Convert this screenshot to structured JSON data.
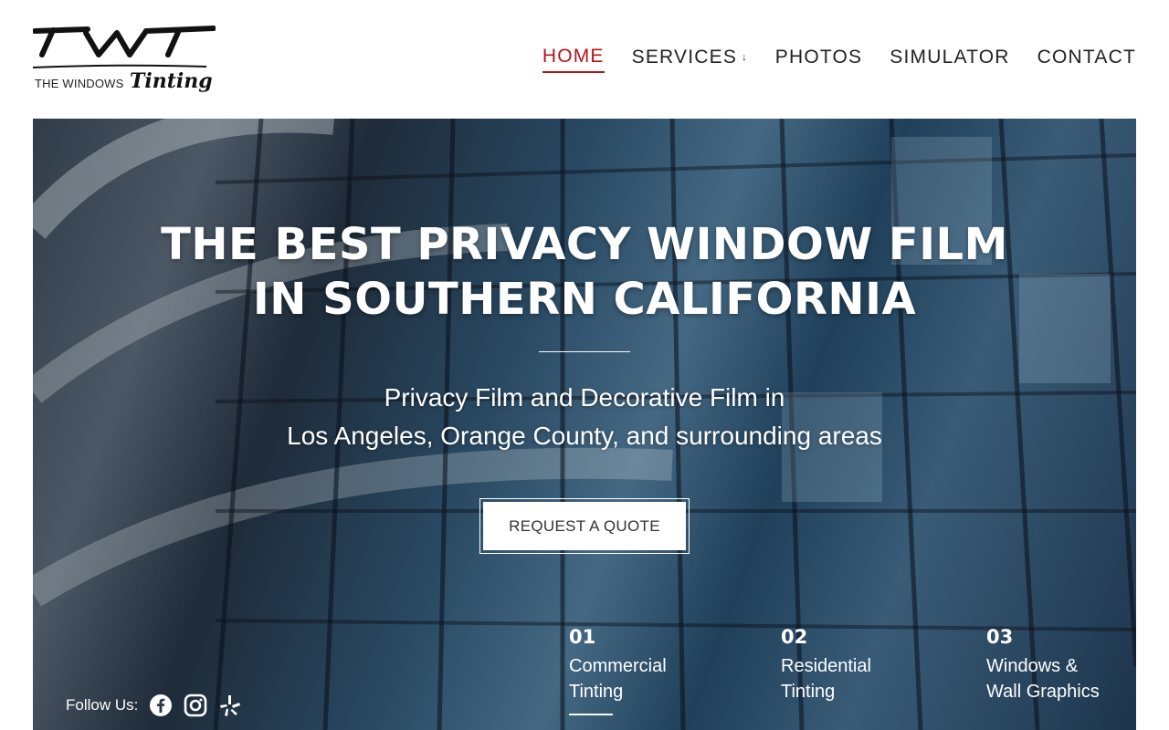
{
  "brand": {
    "logo_mark": "TWT",
    "logo_sub": "THE WINDOWS",
    "logo_script": "Tinting"
  },
  "nav": {
    "items": [
      {
        "label": "HOME",
        "active": true
      },
      {
        "label": "SERVICES",
        "has_dropdown": true,
        "chevron": "↓"
      },
      {
        "label": "PHOTOS"
      },
      {
        "label": "SIMULATOR"
      },
      {
        "label": "CONTACT"
      }
    ]
  },
  "hero": {
    "title_line1": "THE BEST PRIVACY WINDOW FILM",
    "title_line2": "IN SOUTHERN CALIFORNIA",
    "subtitle_line1": "Privacy Film and Decorative Film in",
    "subtitle_line2": "Los Angeles, Orange County, and surrounding areas",
    "cta_label": "REQUEST A QUOTE"
  },
  "follow": {
    "label": "Follow Us:",
    "icons": [
      "facebook-icon",
      "instagram-icon",
      "yelp-icon"
    ]
  },
  "services": [
    {
      "num": "01",
      "line1": "Commercial",
      "line2": "Tinting",
      "active": true
    },
    {
      "num": "02",
      "line1": "Residential",
      "line2": "Tinting"
    },
    {
      "num": "03",
      "line1": "Windows &",
      "line2": "Wall Graphics"
    }
  ],
  "colors": {
    "accent": "#b3151b",
    "text": "#222222",
    "hero_overlay": "#0a1423"
  }
}
